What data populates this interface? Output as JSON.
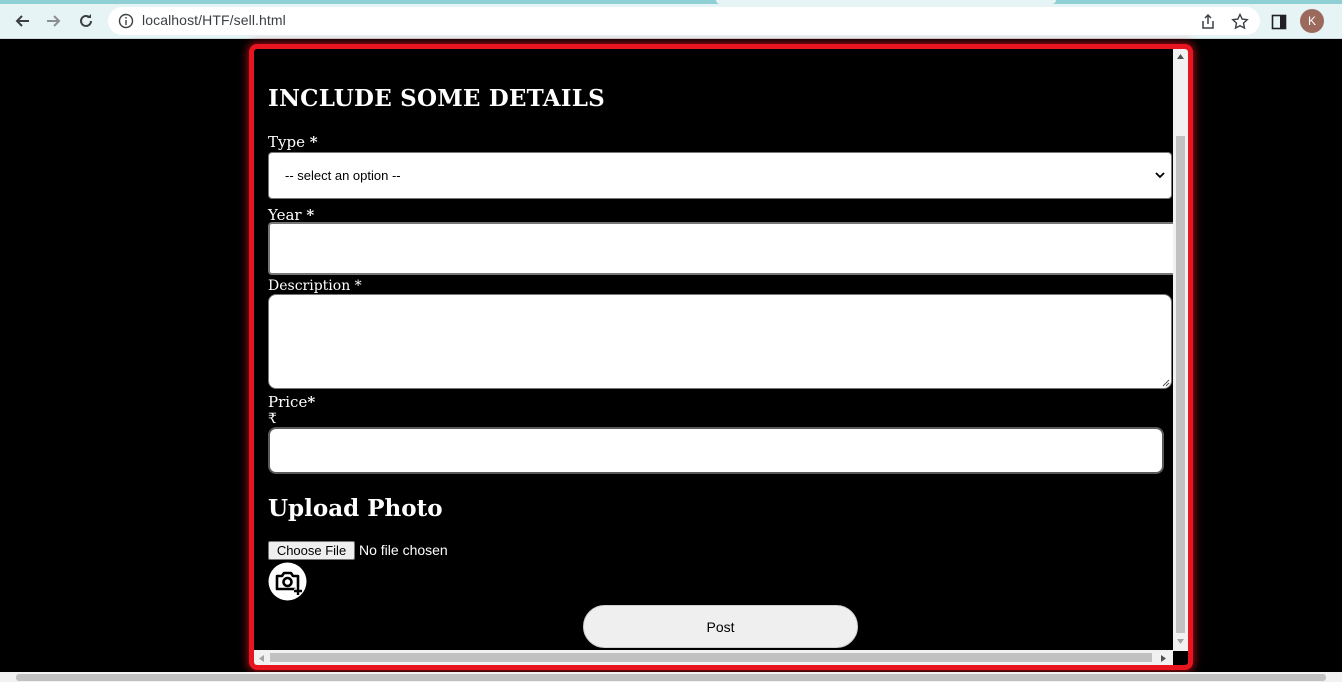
{
  "browser": {
    "url": "localhost/HTF/sell.html",
    "avatar_letter": "K"
  },
  "form": {
    "heading": "INCLUDE SOME DETAILS",
    "type_label": "Type ",
    "type_required": "*",
    "type_selected": "-- select an option --",
    "year_label": "Year ",
    "year_required": "*",
    "year_value": "",
    "description_label": "Description *",
    "description_value": "",
    "price_label": "Price",
    "price_required": "*",
    "currency_symbol": "₹",
    "price_value": "",
    "upload_heading": "Upload Photo",
    "choose_file_label": "Choose File",
    "file_status": "No file chosen",
    "post_label": "Post"
  },
  "colors": {
    "frame_border": "#e8141f",
    "background": "#000000",
    "toolbar": "#e7f4f5"
  },
  "icons": [
    "back-arrow-icon",
    "forward-arrow-icon",
    "reload-icon",
    "info-icon",
    "share-icon",
    "star-icon",
    "side-panel-icon",
    "camera-add-icon",
    "chevron-down-icon"
  ]
}
